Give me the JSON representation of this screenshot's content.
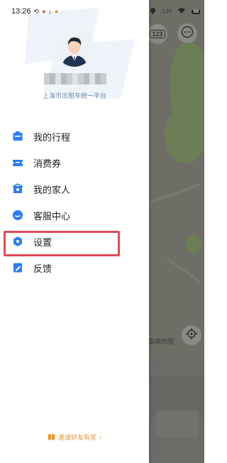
{
  "status": {
    "time": "13:26",
    "map_signal": "1.20",
    "battery": "59"
  },
  "user": {
    "platform_label": "上海市出租车统一平台"
  },
  "menu": [
    {
      "label": "我的行程",
      "icon": "trip-icon",
      "color": "#2b7ef5"
    },
    {
      "label": "消费券",
      "icon": "coupon-icon",
      "color": "#2b7ef5"
    },
    {
      "label": "我的家人",
      "icon": "family-icon",
      "color": "#2b7ef5"
    },
    {
      "label": "客服中心",
      "icon": "customer-service-icon",
      "color": "#2b7ef5"
    },
    {
      "label": "设置",
      "icon": "settings-icon",
      "color": "#2b7ef5"
    },
    {
      "label": "反馈",
      "icon": "feedback-icon",
      "color": "#2b7ef5"
    }
  ],
  "invite": {
    "label": "邀请好友有奖",
    "arrow": "›"
  },
  "map": {
    "plate_button": "123",
    "map_label": "高德地图"
  },
  "colors": {
    "accent": "#2b7ef5",
    "highlight_border": "#e14b55",
    "invite": "#f0932a",
    "platform_text": "#6b86a8"
  }
}
